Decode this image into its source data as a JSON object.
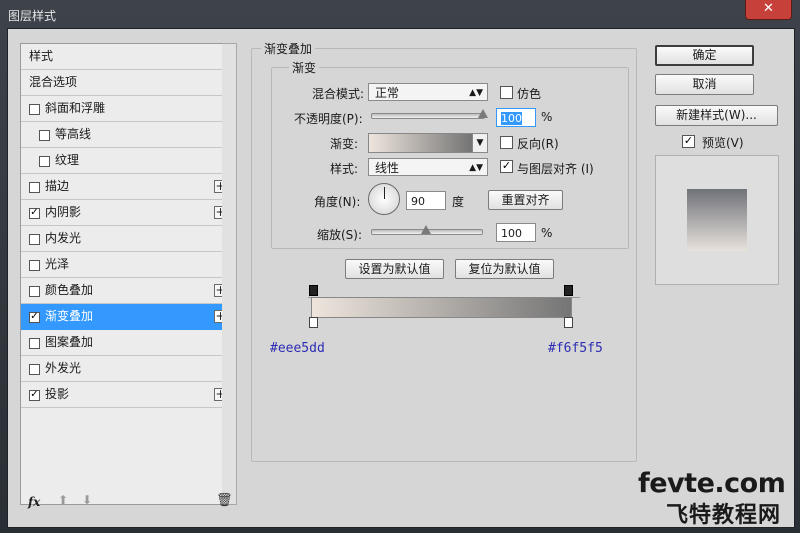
{
  "window": {
    "title": "图层样式",
    "close_glyph": "✕"
  },
  "styles_list": {
    "items": [
      {
        "label": "样式",
        "checkbox": false,
        "checked": false,
        "plus": false,
        "indent": 0,
        "active": false
      },
      {
        "label": "混合选项",
        "checkbox": false,
        "checked": false,
        "plus": false,
        "indent": 0,
        "active": false
      },
      {
        "label": "斜面和浮雕",
        "checkbox": true,
        "checked": false,
        "plus": false,
        "indent": 0,
        "active": false
      },
      {
        "label": "等高线",
        "checkbox": true,
        "checked": false,
        "plus": false,
        "indent": 1,
        "active": false
      },
      {
        "label": "纹理",
        "checkbox": true,
        "checked": false,
        "plus": false,
        "indent": 1,
        "active": false
      },
      {
        "label": "描边",
        "checkbox": true,
        "checked": false,
        "plus": true,
        "indent": 0,
        "active": false
      },
      {
        "label": "内阴影",
        "checkbox": true,
        "checked": true,
        "plus": true,
        "indent": 0,
        "active": false
      },
      {
        "label": "内发光",
        "checkbox": true,
        "checked": false,
        "plus": false,
        "indent": 0,
        "active": false
      },
      {
        "label": "光泽",
        "checkbox": true,
        "checked": false,
        "plus": false,
        "indent": 0,
        "active": false
      },
      {
        "label": "颜色叠加",
        "checkbox": true,
        "checked": false,
        "plus": true,
        "indent": 0,
        "active": false
      },
      {
        "label": "渐变叠加",
        "checkbox": true,
        "checked": true,
        "plus": true,
        "indent": 0,
        "active": true
      },
      {
        "label": "图案叠加",
        "checkbox": true,
        "checked": false,
        "plus": false,
        "indent": 0,
        "active": false
      },
      {
        "label": "外发光",
        "checkbox": true,
        "checked": false,
        "plus": false,
        "indent": 0,
        "active": false
      },
      {
        "label": "投影",
        "checkbox": true,
        "checked": true,
        "plus": true,
        "indent": 0,
        "active": false
      }
    ],
    "plus_glyph": "+",
    "check_glyph": "✓",
    "bottom": {
      "fx_icon": "fx",
      "up_icon": "⬆",
      "down_icon": "⬇",
      "trash_icon": "🗑"
    }
  },
  "gradient_overlay": {
    "section_title": "渐变叠加",
    "subsection_title": "渐变",
    "blend_mode_label": "混合模式:",
    "blend_mode_value": "正常",
    "dither_label": "仿色",
    "opacity_label": "不透明度(P):",
    "opacity_value": "100",
    "opacity_fraction": 1.0,
    "percent": "%",
    "gradient_label": "渐变:",
    "reverse_label": "反向(R)",
    "style_label": "样式:",
    "style_value": "线性",
    "align_label": "与图层对齐 (I)",
    "angle_label": "角度(N):",
    "angle_value": "90",
    "degree_label": "度",
    "reset_align_button": "重置对齐",
    "scale_label": "缩放(S):",
    "scale_value": "100",
    "scale_fraction": 0.5,
    "set_default_button": "设置为默认值",
    "reset_default_button": "复位为默认值"
  },
  "gradient_editor": {
    "start_color": "#eee5dd",
    "end_color": "#f6f5f5",
    "start_hex_label": "#eee5dd",
    "end_hex_label": "#f6f5f5"
  },
  "right_panel": {
    "ok_button": "确定",
    "cancel_button": "取消",
    "new_style_button": "新建样式(W)...",
    "preview_label": "预览(V)",
    "preview_checked": true
  },
  "watermark": {
    "line1": "fevte.com",
    "line2": "飞特教程网"
  },
  "colors": {
    "accent": "#3399ff",
    "hex_label": "#2d2db4",
    "dialog_bg": "#d6d6d6"
  }
}
